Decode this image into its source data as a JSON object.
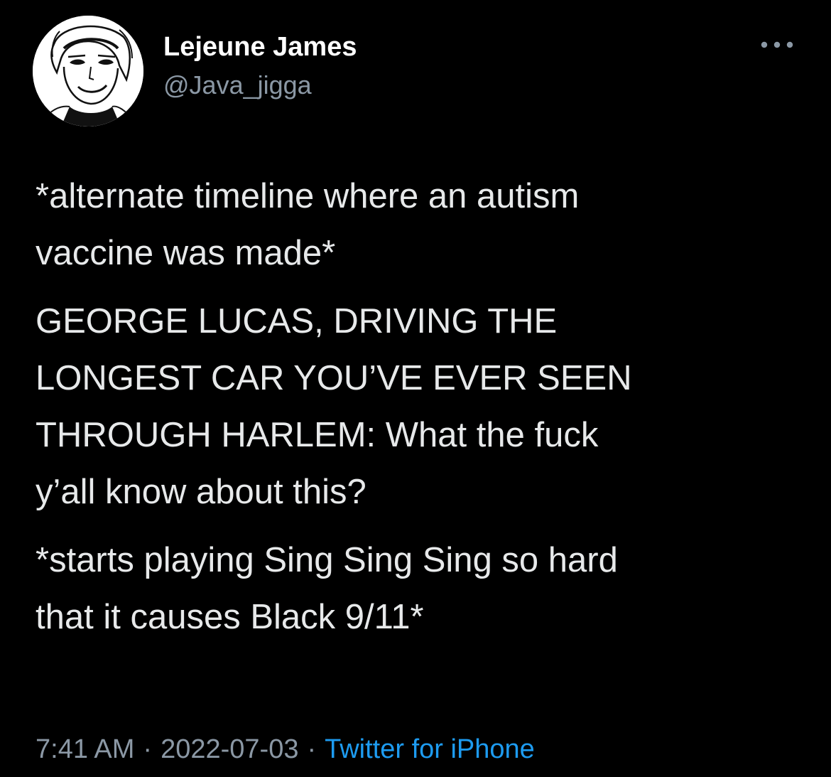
{
  "author": {
    "display_name": "Lejeune James",
    "handle": "@Java_jigga"
  },
  "icons": {
    "avatar": "avatar-illustration",
    "more": "more-horizontal-icon"
  },
  "tweet": {
    "paragraphs": [
      "*alternate timeline where an autism\nvaccine was made*",
      "GEORGE LUCAS, DRIVING THE\nLONGEST CAR YOU’VE EVER SEEN\nTHROUGH HARLEM: What the fuck\ny’all know about this?",
      "*starts playing Sing Sing Sing so hard\nthat it causes Black 9/11*"
    ]
  },
  "meta": {
    "time": "7:41 AM",
    "separator": "·",
    "date": "2022-07-03",
    "source": "Twitter for iPhone"
  },
  "colors": {
    "background": "#000000",
    "text": "#e7e9ea",
    "secondary": "#8b98a5",
    "link": "#1d9bf0"
  }
}
